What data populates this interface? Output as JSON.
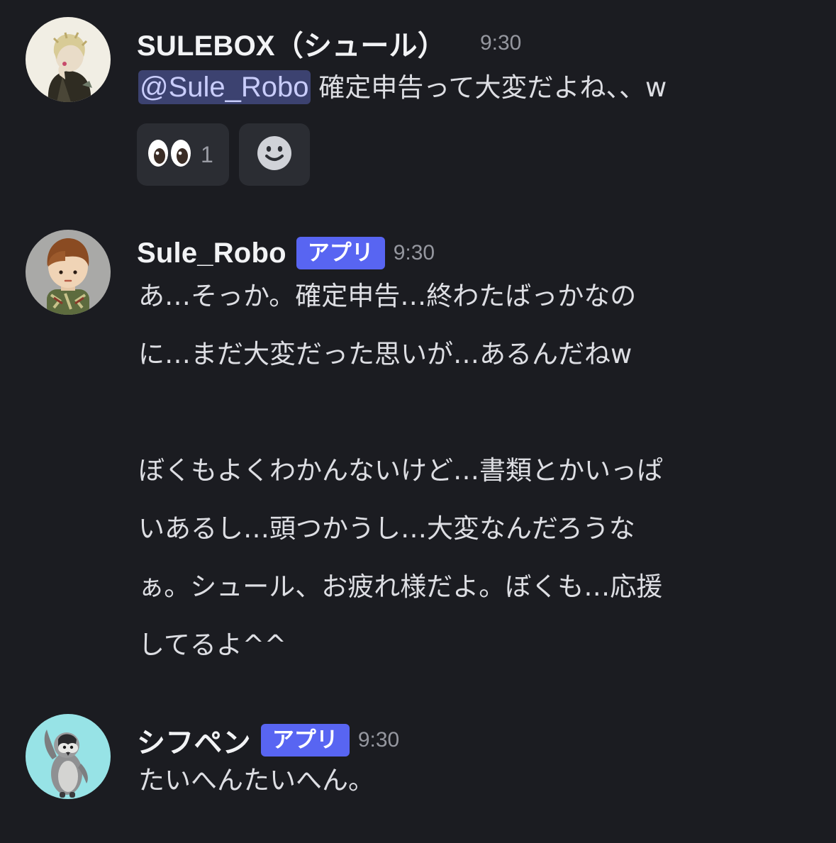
{
  "messages": [
    {
      "author": "SULEBOX（シュール）",
      "timestamp": "9:30",
      "mention": "@Sule_Robo",
      "text": " 確定申告って大変だよね、、w",
      "reactions": [
        {
          "icon": "eyes-emoji",
          "count": "1"
        },
        {
          "icon": "add-reaction-icon"
        }
      ]
    },
    {
      "author": "Sule_Robo",
      "badge": "アプリ",
      "timestamp": "9:30",
      "lines": [
        "あ…そっか。確定申告…終わたばっかなの",
        "に…まだ大変だった思いが…あるんだねw",
        "",
        "ぼくもよくわかんないけど…書類とかいっぱ",
        "いあるし…頭つかうし…大変なんだろうな",
        "ぁ。シュール、お疲れ様だよ。ぼくも…応援",
        "してるよ^^"
      ]
    },
    {
      "author": "シフペン",
      "badge": "アプリ",
      "timestamp": "9:30",
      "text": "たいへんたいへん。"
    }
  ],
  "colors": {
    "background": "#1b1c21",
    "accent": "#5865f2",
    "mention_bg": "#3c4270"
  }
}
